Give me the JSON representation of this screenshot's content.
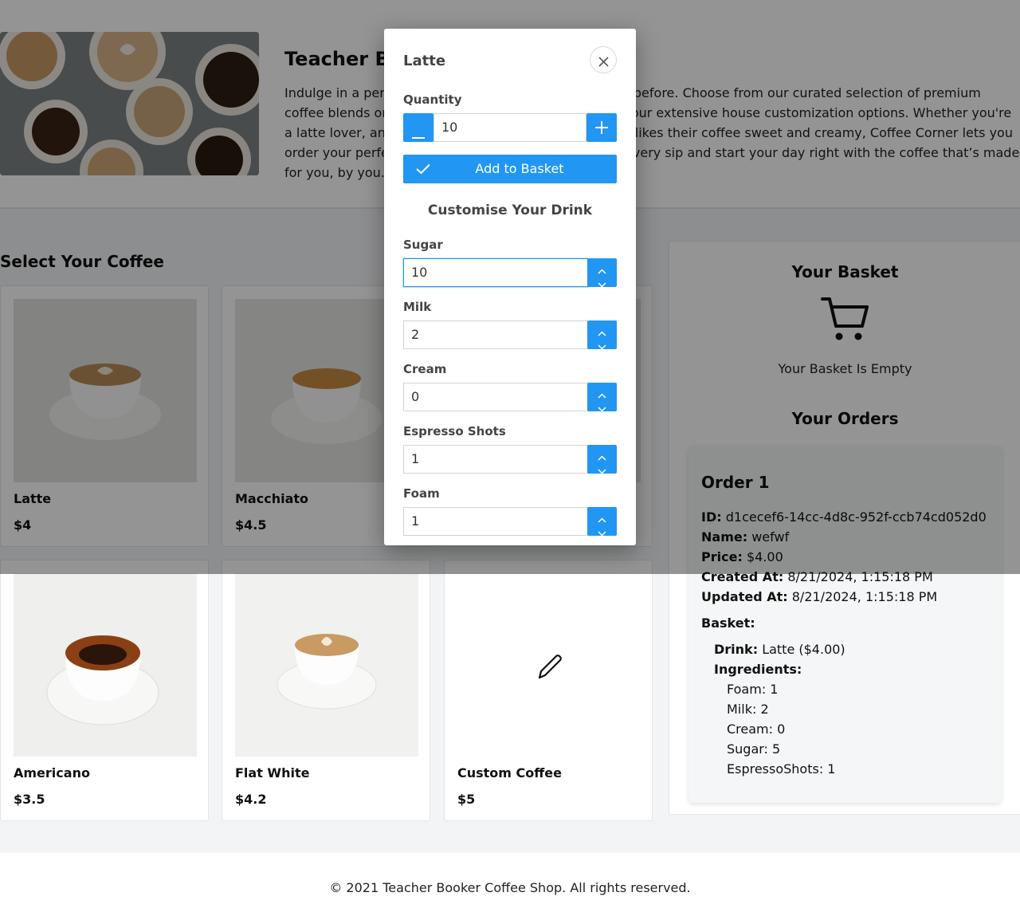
{
  "hero": {
    "title": "Teacher Booker Coffee Shop",
    "text": "Indulge in a personalized coffee experience like never before. Choose from our curated selection of premium coffee blends or craft your own unique beverage with our extensive house customization options. Whether you're a latte lover, an espresso enthusiast, or someone who likes their coffee sweet and creamy, Coffee Corner lets you order your perfect cup just the way you like it. Savor every sip and start your day right with the coffee that’s made for you, by you."
  },
  "menu": {
    "title": "Select Your Coffee",
    "items": [
      {
        "name": "Latte",
        "price": "$4"
      },
      {
        "name": "Macchiato",
        "price": "$4.5"
      },
      {
        "name": "",
        "price": ""
      },
      {
        "name": "Americano",
        "price": "$3.5"
      },
      {
        "name": "Flat White",
        "price": "$4.2"
      },
      {
        "name": "Custom Coffee",
        "price": "$5"
      }
    ]
  },
  "basket": {
    "title": "Your Basket",
    "empty_text": "Your Basket Is Empty",
    "orders_title": "Your Orders"
  },
  "order": {
    "title": "Order 1",
    "id_label": "ID:",
    "id": "d1cecef6-14cc-4d8c-952f-ccb74cd052d0",
    "name_label": "Name:",
    "name": "wefwf",
    "price_label": "Price:",
    "price": "$4.00",
    "created_label": "Created At:",
    "created": "8/21/2024, 1:15:18 PM",
    "updated_label": "Updated At:",
    "updated": "8/21/2024, 1:15:18 PM",
    "basket_label": "Basket:",
    "drink_label": "Drink:",
    "drink": "Latte ($4.00)",
    "ingredients_label": "Ingredients:",
    "ingredients": [
      "Foam: 1",
      "Milk: 2",
      "Cream: 0",
      "Sugar: 5",
      "EspressoShots: 1"
    ]
  },
  "footer": {
    "text": "© 2021 Teacher Booker Coffee Shop. All rights reserved."
  },
  "modal": {
    "title": "Latte",
    "quantity_label": "Quantity",
    "quantity": "10",
    "add_label": "Add to Basket",
    "customise_title": "Customise Your Drink",
    "fields": [
      {
        "label": "Sugar",
        "value": "10"
      },
      {
        "label": "Milk",
        "value": "2"
      },
      {
        "label": "Cream",
        "value": "0"
      },
      {
        "label": "Espresso Shots",
        "value": "1"
      },
      {
        "label": "Foam",
        "value": "1"
      }
    ]
  },
  "colors": {
    "accent": "#2196f3",
    "overlay": "rgba(0,0,0,0.42)",
    "page_bg": "#f3f4f6"
  }
}
